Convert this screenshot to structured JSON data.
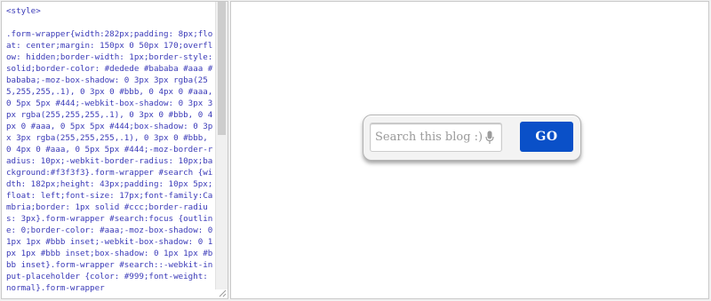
{
  "editor": {
    "code": "<style>\n\n.form-wrapper{width:282px;padding: 8px;float: center;margin: 150px 0 50px 170;overflow: hidden;border-width: 1px;border-style: solid;border-color: #dedede #bababa #aaa #bababa;-moz-box-shadow: 0 3px 3px rgba(255,255,255,.1), 0 3px 0 #bbb, 0 4px 0 #aaa, 0 5px 5px #444;-webkit-box-shadow: 0 3px 3px rgba(255,255,255,.1), 0 3px 0 #bbb, 0 4px 0 #aaa, 0 5px 5px #444;box-shadow: 0 3px 3px rgba(255,255,255,.1), 0 3px 0 #bbb, 0 4px 0 #aaa, 0 5px 5px #444;-moz-border-radius: 10px;-webkit-border-radius: 10px;background:#f3f3f3}.form-wrapper #search {width: 182px;height: 43px;padding: 10px 5px;float: left;font-size: 17px;font-family:Cambria;border: 1px solid #ccc;border-radius: 3px}.form-wrapper #search:focus {outline: 0;border-color: #aaa;-moz-box-shadow: 0 1px 1px #bbb inset;-webkit-box-shadow: 0 1px 1px #bbb inset;box-shadow: 0 1px 1px #bbb inset}.form-wrapper #search::-webkit-input-placeholder {color: #999;font-weight: normal}.form-wrapper"
  },
  "preview": {
    "search": {
      "placeholder": "Search this blog :)",
      "value": ""
    },
    "go_label": "GO",
    "mic_icon": "microphone-icon"
  },
  "colors": {
    "code_text": "#3a3ab8",
    "go_button": "#0a50c8",
    "form_background": "#f3f3f3"
  }
}
